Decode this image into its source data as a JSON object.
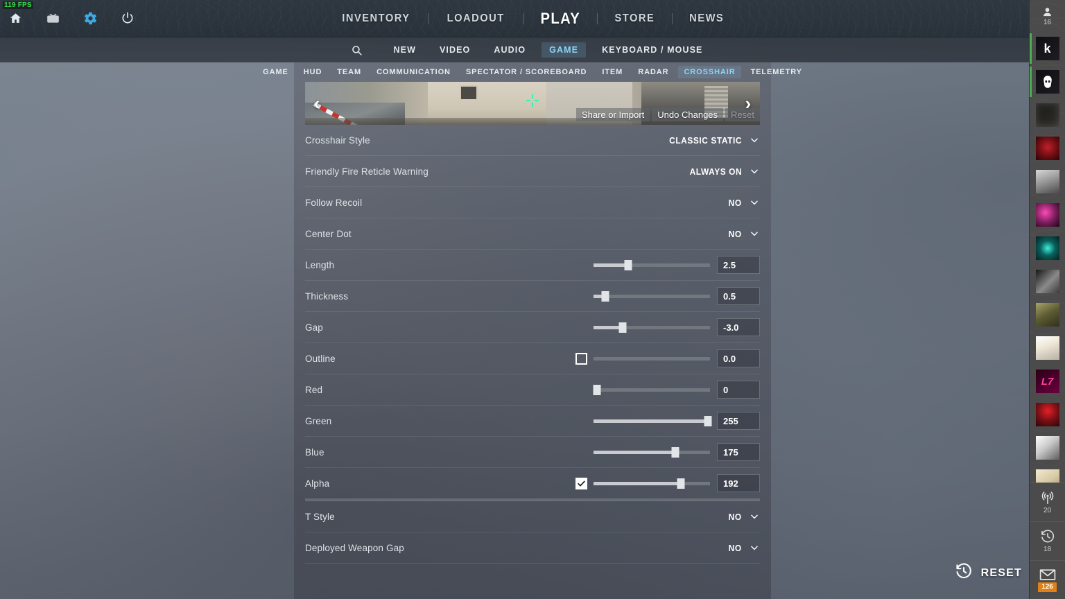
{
  "hud": {
    "fps": "119 FPS",
    "system_icons": [
      {
        "name": "home-icon",
        "label": "Home"
      },
      {
        "name": "watch-icon",
        "label": "Watch"
      },
      {
        "name": "settings-gear-icon",
        "label": "Settings"
      },
      {
        "name": "power-icon",
        "label": "Power"
      }
    ]
  },
  "main_nav": {
    "items": [
      {
        "label": "INVENTORY",
        "active": false
      },
      {
        "label": "LOADOUT",
        "active": false
      },
      {
        "label": "PLAY",
        "active": true
      },
      {
        "label": "STORE",
        "active": false
      },
      {
        "label": "NEWS",
        "active": false
      }
    ]
  },
  "settings_tabs": {
    "search_icon": "search-icon",
    "items": [
      {
        "label": "NEW",
        "active": false
      },
      {
        "label": "VIDEO",
        "active": false
      },
      {
        "label": "AUDIO",
        "active": false
      },
      {
        "label": "GAME",
        "active": true
      },
      {
        "label": "KEYBOARD / MOUSE",
        "active": false
      }
    ]
  },
  "sub_tabs": {
    "items": [
      {
        "label": "GAME",
        "active": false
      },
      {
        "label": "HUD",
        "active": false
      },
      {
        "label": "TEAM",
        "active": false
      },
      {
        "label": "COMMUNICATION",
        "active": false
      },
      {
        "label": "SPECTATOR / SCOREBOARD",
        "active": false
      },
      {
        "label": "ITEM",
        "active": false
      },
      {
        "label": "RADAR",
        "active": false
      },
      {
        "label": "CROSSHAIR",
        "active": true
      },
      {
        "label": "TELEMETRY",
        "active": false
      }
    ]
  },
  "preview": {
    "prev_arrow": "‹",
    "next_arrow": "›",
    "buttons": [
      {
        "label": "Share or Import",
        "dim": false
      },
      {
        "label": "Undo Changes",
        "dim": false
      },
      {
        "label": "Reset",
        "dim": true
      }
    ],
    "crosshair_color": "#00ffaf"
  },
  "settings_rows": [
    {
      "type": "dropdown",
      "label": "Crosshair Style",
      "value": "CLASSIC STATIC"
    },
    {
      "type": "dropdown",
      "label": "Friendly Fire Reticle Warning",
      "value": "ALWAYS ON"
    },
    {
      "type": "dropdown",
      "label": "Follow Recoil",
      "value": "NO"
    },
    {
      "type": "dropdown",
      "label": "Center Dot",
      "value": "NO"
    },
    {
      "type": "slider",
      "label": "Length",
      "value": "2.5",
      "percent": 30,
      "checkbox": null
    },
    {
      "type": "slider",
      "label": "Thickness",
      "value": "0.5",
      "percent": 10,
      "checkbox": null
    },
    {
      "type": "slider",
      "label": "Gap",
      "value": "-3.0",
      "percent": 25,
      "checkbox": null
    },
    {
      "type": "slider",
      "label": "Outline",
      "value": "0.0",
      "percent": 0,
      "checkbox": false
    },
    {
      "type": "slider",
      "label": "Red",
      "value": "0",
      "percent": 3,
      "checkbox": null
    },
    {
      "type": "slider",
      "label": "Green",
      "value": "255",
      "percent": 98,
      "checkbox": null
    },
    {
      "type": "slider",
      "label": "Blue",
      "value": "175",
      "percent": 70,
      "checkbox": null
    },
    {
      "type": "slider",
      "label": "Alpha",
      "value": "192",
      "percent": 75,
      "checkbox": true,
      "thick_divider": true
    },
    {
      "type": "dropdown",
      "label": "T Style",
      "value": "NO"
    },
    {
      "type": "dropdown",
      "label": "Deployed Weapon Gap",
      "value": "NO"
    }
  ],
  "bottom": {
    "reset_label": "RESET",
    "reset_icon": "history-reset-icon"
  },
  "friends_sidebar": {
    "header": {
      "icon": "person-icon",
      "count": "16"
    },
    "friends": [
      {
        "name": "friend-avatar-1",
        "online": true,
        "c1": "#101014",
        "c2": "#1c1c22",
        "glyph": "k",
        "glyph_color": "#ffffff"
      },
      {
        "name": "friend-avatar-2",
        "online": true,
        "c1": "#101014",
        "c2": "#1a1a20",
        "glyph": "☹",
        "glyph_color": "#ffffff"
      },
      {
        "name": "friend-avatar-3",
        "online": false,
        "c1": "#1a1a18",
        "c2": "#2e2c26",
        "glyph": "",
        "glyph_color": "#cccccc"
      },
      {
        "name": "friend-avatar-4",
        "online": false,
        "c1": "#6b0d12",
        "c2": "#2a0406",
        "glyph": "",
        "glyph_color": "#ff6b6b"
      },
      {
        "name": "friend-avatar-5",
        "online": false,
        "c1": "#9a9a9a",
        "c2": "#4a4a4a",
        "glyph": "",
        "glyph_color": "#ffffff"
      },
      {
        "name": "friend-avatar-6",
        "online": false,
        "c1": "#3a0a2a",
        "c2": "#7d1f5e",
        "glyph": "",
        "glyph_color": "#ff7ad9"
      },
      {
        "name": "friend-avatar-7",
        "online": false,
        "c1": "#03201f",
        "c2": "#0a5f5c",
        "glyph": "",
        "glyph_color": "#44ffe8"
      },
      {
        "name": "friend-avatar-8",
        "online": false,
        "c1": "#151515",
        "c2": "#555555",
        "glyph": "",
        "glyph_color": "#dddddd"
      },
      {
        "name": "friend-avatar-9",
        "online": false,
        "c1": "#5a5a32",
        "c2": "#31301c",
        "glyph": "",
        "glyph_color": "#d8d8a8"
      },
      {
        "name": "friend-avatar-10",
        "online": false,
        "c1": "#f0f0f0",
        "c2": "#b8b0a0",
        "glyph": "",
        "glyph_color": "#666666"
      },
      {
        "name": "friend-avatar-11",
        "online": false,
        "c1": "#2a0014",
        "c2": "#6b0040",
        "glyph": "L7",
        "glyph_color": "#ff3ea5"
      },
      {
        "name": "friend-avatar-12",
        "online": false,
        "c1": "#7a1016",
        "c2": "#2a0608",
        "glyph": "",
        "glyph_color": "#ff4444"
      },
      {
        "name": "friend-avatar-13",
        "online": false,
        "c1": "#c9c9c9",
        "c2": "#6e6e6e",
        "glyph": "",
        "glyph_color": "#ffffff"
      },
      {
        "name": "friend-avatar-14",
        "online": false,
        "c1": "#e8dcc0",
        "c2": "#b9a87e",
        "glyph": "",
        "glyph_color": "#7a6a4a"
      }
    ],
    "bottom_items": [
      {
        "name": "broadcast-icon",
        "count": "20",
        "badge": null
      },
      {
        "name": "history-icon",
        "count": "18",
        "badge": null
      },
      {
        "name": "mail-icon",
        "count": null,
        "badge": "126"
      }
    ]
  }
}
